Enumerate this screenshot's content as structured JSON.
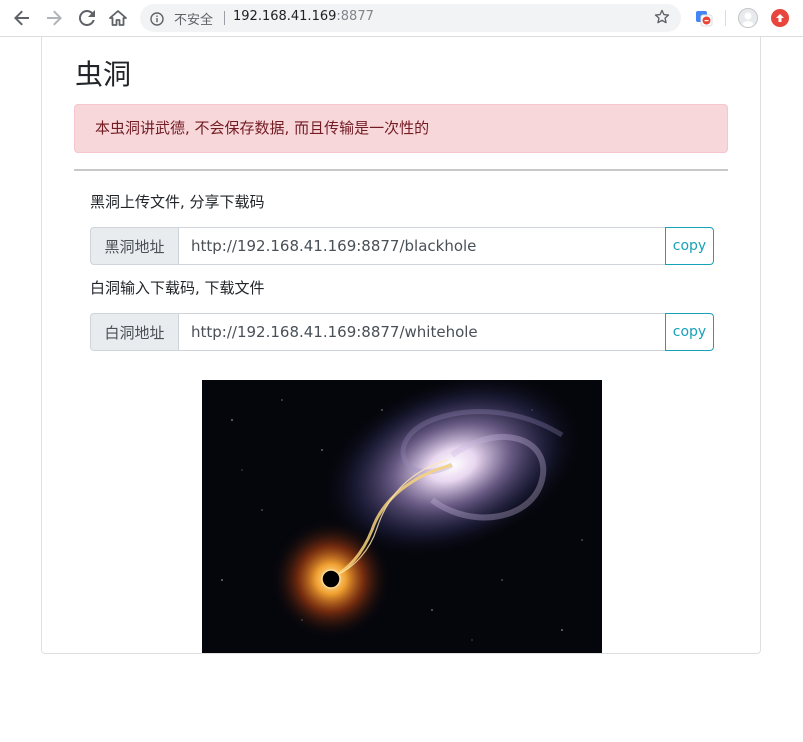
{
  "browser": {
    "security_label": "不安全",
    "url_host": "192.168.41.169",
    "url_port": ":8877",
    "icons": [
      "back-arrow-icon",
      "forward-arrow-icon",
      "reload-icon",
      "home-icon",
      "info-icon",
      "star-icon",
      "translate-icon",
      "avatar-icon",
      "update-icon"
    ]
  },
  "page": {
    "title": "虫洞",
    "alert": "本虫洞讲武德, 不会保存数据, 而且传输是一次性的",
    "blackhole": {
      "description": "黑洞上传文件, 分享下载码",
      "label": "黑洞地址",
      "value": "http://192.168.41.169:8877/blackhole",
      "copy_label": "copy"
    },
    "whitehole": {
      "description": "白洞输入下载码, 下载文件",
      "label": "白洞地址",
      "value": "http://192.168.41.169:8877/whitehole",
      "copy_label": "copy"
    }
  },
  "colors": {
    "alert_bg": "#f8d7da",
    "alert_text": "#721c24",
    "copy_button": "#17a2b8",
    "update_badge": "#e8453c"
  }
}
